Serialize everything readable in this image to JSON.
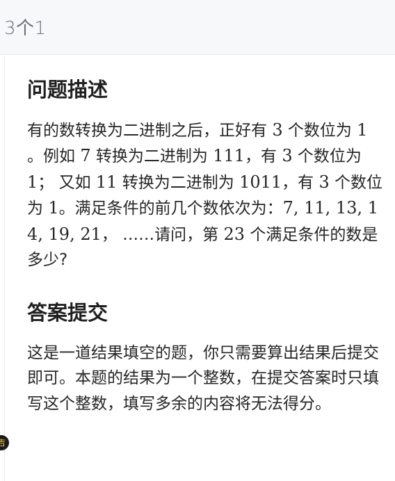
{
  "header": {
    "title": "3个1"
  },
  "problem": {
    "heading": "问题描述",
    "segments": [
      {
        "t": "有的数转换为二进制之后，正好有 ",
        "m": false
      },
      {
        "t": "3",
        "m": true
      },
      {
        "t": " 个数位为 ",
        "m": false
      },
      {
        "t": "1",
        "m": true
      },
      {
        "t": " 。例如 ",
        "m": false
      },
      {
        "t": "7",
        "m": true
      },
      {
        "t": " 转换为二进制为 ",
        "m": false
      },
      {
        "t": "111",
        "m": true
      },
      {
        "t": "，有 ",
        "m": false
      },
      {
        "t": "3",
        "m": true
      },
      {
        "t": " 个数位为 ",
        "m": false
      },
      {
        "t": "1",
        "m": true
      },
      {
        "t": "； 又如 ",
        "m": false
      },
      {
        "t": "11",
        "m": true
      },
      {
        "t": " 转换为二进制为 ",
        "m": false
      },
      {
        "t": "1011",
        "m": true
      },
      {
        "t": "，有 ",
        "m": false
      },
      {
        "t": "3",
        "m": true
      },
      {
        "t": " 个数位为 ",
        "m": false
      },
      {
        "t": "1",
        "m": true
      },
      {
        "t": "。满足条件的前几个数依次为：",
        "m": false
      },
      {
        "t": "7, 11, 13, 14, 19, 21",
        "m": true
      },
      {
        "t": "， ……请问，第 ",
        "m": false
      },
      {
        "t": "23",
        "m": true
      },
      {
        "t": " 个满足条件的数是多少?",
        "m": false
      }
    ]
  },
  "answer": {
    "heading": "答案提交",
    "text": "这是一道结果填空的题，你只需要算出结果后提交即可。本题的结果为一个整数，在提交答案时只填写这个整数，填写多余的内容将无法得分。"
  },
  "badge": {
    "text": "吉",
    "icon": "floating-badge-icon"
  }
}
